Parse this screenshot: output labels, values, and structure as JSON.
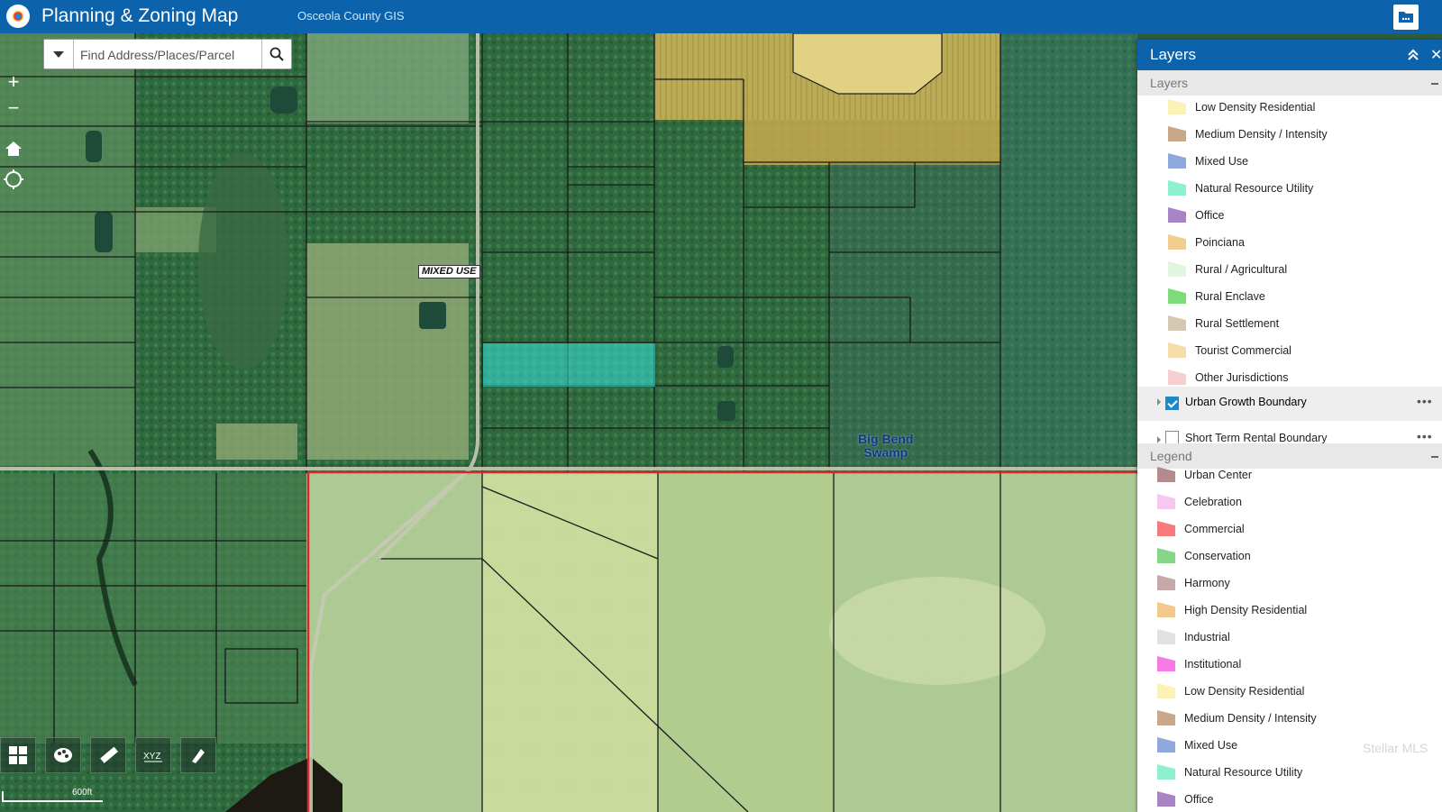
{
  "header": {
    "title": "Planning & Zoning Map",
    "subtitle": "Osceola County GIS"
  },
  "search": {
    "placeholder": "Find Address/Places/Parcel"
  },
  "map": {
    "labels": {
      "mixed_use": "MIXED USE",
      "big_bend_line1": "Big Bend",
      "big_bend_line2": "Swamp"
    },
    "scale_label": "600ft"
  },
  "panel": {
    "title": "Layers",
    "layers_section_label": "Layers",
    "layers_items": [
      {
        "label": "Low Density Residential",
        "color": "#fbf3b5"
      },
      {
        "label": "Medium Density / Intensity",
        "color": "#c9a88a"
      },
      {
        "label": "Mixed Use",
        "color": "#8fa8dd"
      },
      {
        "label": "Natural Resource Utility",
        "color": "#8ff0d0"
      },
      {
        "label": "Office",
        "color": "#a884c4"
      },
      {
        "label": "Poinciana",
        "color": "#f1cd8f"
      },
      {
        "label": "Rural / Agricultural",
        "color": "#e1f6df"
      },
      {
        "label": "Rural Enclave",
        "color": "#7ddc7a"
      },
      {
        "label": "Rural Settlement",
        "color": "#d3c9b3"
      },
      {
        "label": "Tourist Commercial",
        "color": "#f6dca8"
      },
      {
        "label": "Other Jurisdictions",
        "color": "#f6d0d0"
      }
    ],
    "urban_growth_label": "Urban Growth Boundary",
    "short_term_label": "Short Term Rental Boundary",
    "watermark": "Stellar MLS",
    "legend_section_label": "Legend",
    "legend_items": [
      {
        "label": "Urban Center",
        "color": "#b48a8c"
      },
      {
        "label": "Celebration",
        "color": "#f6c8ef"
      },
      {
        "label": "Commercial",
        "color": "#f67a7a"
      },
      {
        "label": "Conservation",
        "color": "#86d68a"
      },
      {
        "label": "Harmony",
        "color": "#c7a8aa"
      },
      {
        "label": "High Density Residential",
        "color": "#f1c98a"
      },
      {
        "label": "Industrial",
        "color": "#e2e2e2"
      },
      {
        "label": "Institutional",
        "color": "#f77ae6"
      },
      {
        "label": "Low Density Residential",
        "color": "#fbf3b5"
      },
      {
        "label": "Medium Density / Intensity",
        "color": "#c9a88a"
      },
      {
        "label": "Mixed Use",
        "color": "#8fa8dd"
      },
      {
        "label": "Natural Resource Utility",
        "color": "#8ff0d0"
      },
      {
        "label": "Office",
        "color": "#a884c4"
      }
    ]
  },
  "colors": {
    "header_blue": "#0d63ab",
    "selected_parcel": "#38e6e0",
    "boundary_red": "#d8262a"
  }
}
